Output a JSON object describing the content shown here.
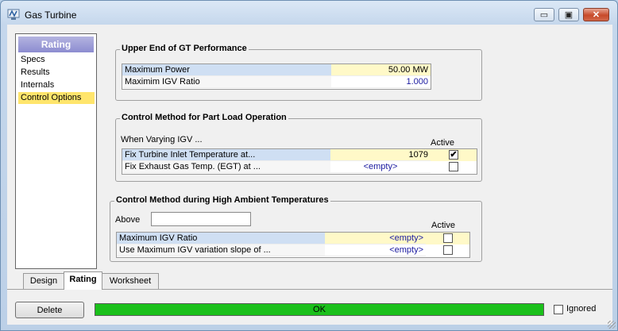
{
  "window": {
    "title": "Gas Turbine",
    "controls": {
      "minimize": "▭",
      "restore": "▣",
      "close": "✕"
    }
  },
  "nav": {
    "header": "Rating",
    "items": [
      "Specs",
      "Results",
      "Internals",
      "Control Options"
    ],
    "selected": "Control Options"
  },
  "upper": {
    "title": "Upper End of GT Performance",
    "rows": [
      {
        "label": "Maximum Power",
        "value": "50.00 MW"
      },
      {
        "label": "Maximim IGV Ratio",
        "value": "1.000"
      }
    ]
  },
  "partload": {
    "title": "Control Method for Part Load Operation",
    "subtitle": "When Varying IGV ...",
    "active_header": "Active",
    "rows": [
      {
        "label": "Fix Turbine Inlet Temperature at...",
        "value": "1079",
        "active": "✔"
      },
      {
        "label": "Fix Exhaust Gas Temp. (EGT) at ...",
        "value": "<empty>",
        "active": ""
      }
    ]
  },
  "highamb": {
    "title": "Control Method during High Ambient Temperatures",
    "above_label": "Above",
    "above_value": "",
    "active_header": "Active",
    "rows": [
      {
        "label": "Maximum IGV Ratio",
        "value": "<empty>",
        "active": ""
      },
      {
        "label": "Use Maximum IGV variation slope of ...",
        "value": "<empty>",
        "active": ""
      }
    ]
  },
  "tabs": [
    "Design",
    "Rating",
    "Worksheet"
  ],
  "active_tab": "Rating",
  "footer": {
    "delete_label": "Delete",
    "status_text": "OK",
    "ignored_label": "Ignored"
  },
  "colors": {
    "status": "#1bc01b",
    "selected_nav": "#ffe56c",
    "input_yellow": "#fff9c8"
  }
}
